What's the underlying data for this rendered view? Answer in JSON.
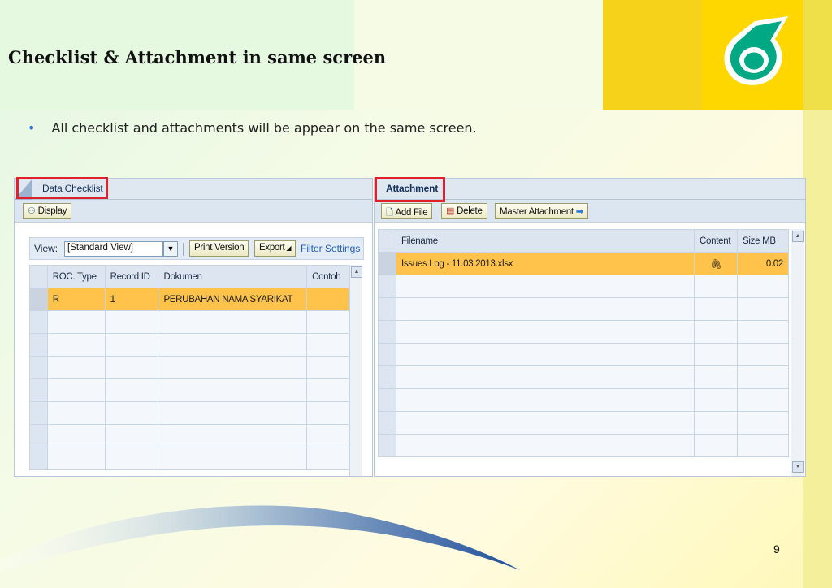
{
  "slide": {
    "title": "Checklist & Attachment in same screen",
    "bullet": "All checklist and attachments will be appear on the same screen.",
    "page_number": "9"
  },
  "left_panel": {
    "tab_label": "Data Checklist",
    "display_button": "Display",
    "view_label": "View:",
    "view_select": "[Standard View]",
    "print_button": "Print Version",
    "export_button": "Export",
    "filter_link": "Filter",
    "settings_link": "Settings",
    "columns": [
      "ROC. Type",
      "Record ID",
      "Dokumen",
      "Contoh"
    ],
    "rows": [
      [
        "R",
        "1",
        "PERUBAHAN NAMA SYARIKAT",
        ""
      ]
    ]
  },
  "right_panel": {
    "tab_label": "Attachment",
    "add_file_button": "Add File",
    "delete_button": "Delete",
    "master_attachment_button": "Master Attachment",
    "columns": [
      "Filename",
      "Content",
      "Size MB"
    ],
    "rows": [
      [
        "Issues Log - 11.03.2013.xlsx",
        "paperclip-icon",
        "0.02"
      ]
    ]
  },
  "colors": {
    "highlight_row": "#ffc24a",
    "redbox": "#e0202a",
    "logo_yellow": "#ffd700",
    "logo_green": "#00a884"
  }
}
